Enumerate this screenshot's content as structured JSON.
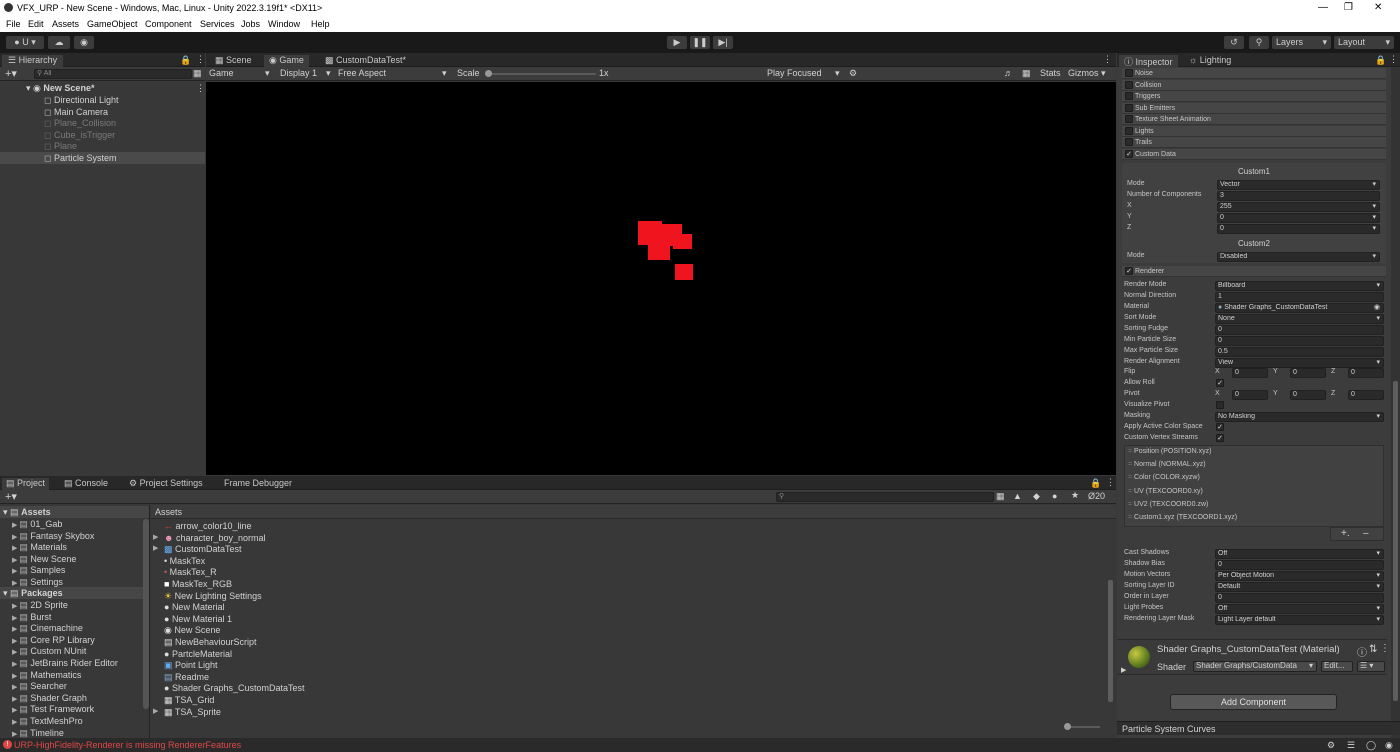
{
  "window": {
    "title": "VFX_URP - New Scene - Windows, Mac, Linux - Unity 2022.3.19f1* <DX11>"
  },
  "menu": [
    "File",
    "Edit",
    "Assets",
    "GameObject",
    "Component",
    "Services",
    "Jobs",
    "Window",
    "Help"
  ],
  "toolbar": {
    "account_label": "U",
    "layers_label": "Layers",
    "layout_label": "Layout"
  },
  "hierarchy": {
    "tab": "Hierarchy",
    "search_placeholder": "All",
    "scene": "New Scene*",
    "items": [
      {
        "name": "Directional Light",
        "dim": false
      },
      {
        "name": "Main Camera",
        "dim": false
      },
      {
        "name": "Plane_Collision",
        "dim": true
      },
      {
        "name": "Cube_isTrigger",
        "dim": true
      },
      {
        "name": "Plane",
        "dim": true
      },
      {
        "name": "Particle System",
        "dim": false
      }
    ]
  },
  "center": {
    "tabs": [
      "Scene",
      "Game",
      "CustomDataTest*"
    ],
    "game_mode": "Game",
    "display": "Display 1",
    "aspect": "Free Aspect",
    "scale_label": "Scale",
    "scale_value": "1x",
    "play_focused": "Play Focused",
    "stats": "Stats",
    "gizmos": "Gizmos"
  },
  "inspector": {
    "tabs": [
      "Inspector",
      "Lighting"
    ],
    "modules": [
      "Noise",
      "Collision",
      "Triggers",
      "Sub Emitters",
      "Texture Sheet Animation",
      "Lights",
      "Trails",
      "Custom Data"
    ],
    "custom1": {
      "title": "Custom1",
      "mode_label": "Mode",
      "mode": "Vector",
      "components_label": "Number of Components",
      "components": "3",
      "x_label": "X",
      "x": "255",
      "y_label": "Y",
      "y": "0",
      "z_label": "Z",
      "z": "0"
    },
    "custom2": {
      "title": "Custom2",
      "mode_label": "Mode",
      "mode": "Disabled"
    },
    "renderer_label": "Renderer",
    "renderer": [
      {
        "label": "Render Mode",
        "value": "Billboard"
      },
      {
        "label": "Normal Direction",
        "value": "1"
      },
      {
        "label": "Material",
        "value": "Shader Graphs_CustomDataTest"
      },
      {
        "label": "Sort Mode",
        "value": "None"
      },
      {
        "label": "Sorting Fudge",
        "value": "0"
      },
      {
        "label": "Min Particle Size",
        "value": "0"
      },
      {
        "label": "Max Particle Size",
        "value": "0.5"
      },
      {
        "label": "Render Alignment",
        "value": "View"
      }
    ],
    "flip_label": "Flip",
    "flip": [
      "0",
      "0",
      "0"
    ],
    "allow_roll_label": "Allow Roll",
    "pivot_label": "Pivot",
    "pivot": [
      "0",
      "0",
      "0"
    ],
    "axis_labels": [
      "X",
      "Y",
      "Z"
    ],
    "visualize_pivot_label": "Visualize Pivot",
    "masking_label": "Masking",
    "masking": "No Masking",
    "apply_color_label": "Apply Active Color Space",
    "vertex_streams_label": "Custom Vertex Streams",
    "streams": [
      "Position (POSITION.xyz)",
      "Normal (NORMAL.xyz)",
      "Color (COLOR.xyzw)",
      "UV (TEXCOORD0.xy)",
      "UV2 (TEXCOORD0.zw)",
      "Custom1.xyz (TEXCOORD1.xyz)"
    ],
    "after": [
      {
        "label": "Cast Shadows",
        "value": "Off"
      },
      {
        "label": "Shadow Bias",
        "value": "0"
      },
      {
        "label": "Motion Vectors",
        "value": "Per Object Motion"
      },
      {
        "label": "Sorting Layer ID",
        "value": "Default"
      },
      {
        "label": "Order in Layer",
        "value": "0"
      },
      {
        "label": "Light Probes",
        "value": "Off"
      },
      {
        "label": "Rendering Layer Mask",
        "value": "Light Layer default"
      }
    ],
    "material_title": "Shader Graphs_CustomDataTest (Material)",
    "shader_label": "Shader",
    "shader_value": "Shader Graphs/CustomData",
    "edit_label": "Edit...",
    "add_component": "Add Component",
    "curves": "Particle System Curves"
  },
  "project": {
    "tabs": [
      "Project",
      "Console",
      "Project Settings",
      "Frame Debugger"
    ],
    "hidden_count": "20",
    "tree_assets": "Assets",
    "asset_folders": [
      "01_Gab",
      "Fantasy Skybox",
      "Materials",
      "New Scene",
      "Samples",
      "Settings"
    ],
    "tree_packages": "Packages",
    "package_folders": [
      "2D Sprite",
      "Burst",
      "Cinemachine",
      "Core RP Library",
      "Custom NUnit",
      "JetBrains Rider Editor",
      "Mathematics",
      "Searcher",
      "Shader Graph",
      "Test Framework",
      "TextMeshPro",
      "Timeline"
    ],
    "breadcrumb": "Assets",
    "files": [
      "arrow_color10_line",
      "character_boy_normal",
      "CustomDataTest",
      "MaskTex",
      "MaskTex_R",
      "MaskTex_RGB",
      "New Lighting Settings",
      "New Material",
      "New Material 1",
      "New Scene",
      "NewBehaviourScript",
      "PartcleMaterial",
      "Point Light",
      "Readme",
      "Shader Graphs_CustomDataTest",
      "TSA_Grid",
      "TSA_Sprite"
    ]
  },
  "status": {
    "error": "URP-HighFidelity-Renderer is missing RendererFeatures"
  },
  "colors": {
    "particle": "#f0141e",
    "error": "#e04848",
    "accent": "#3a72b0"
  }
}
